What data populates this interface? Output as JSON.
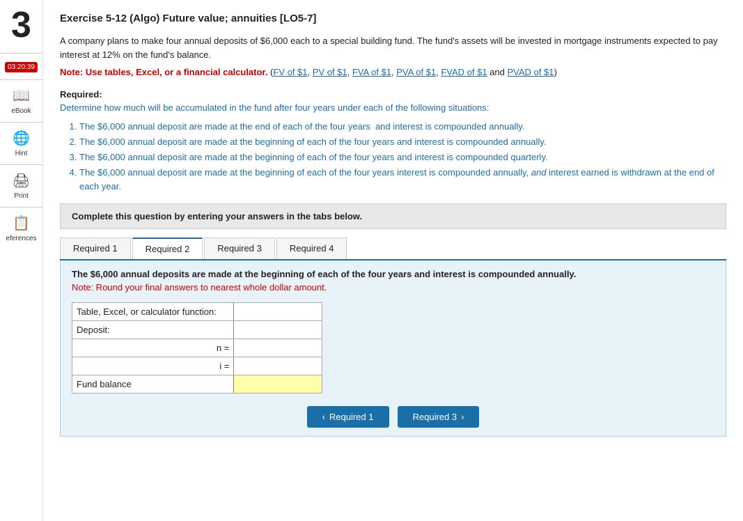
{
  "sidebar": {
    "number": "3",
    "timer": "03:20:39",
    "ebook_label": "eBook",
    "hint_label": "Hint",
    "print_label": "Print",
    "references_label": "eferences"
  },
  "exercise": {
    "title": "Exercise 5-12 (Algo) Future value; annuities [LO5-7]",
    "intro": "A company plans to make four annual deposits of $6,000 each to a special building fund. The fund's assets will be invested in mortgage instruments expected to pay interest at 12% on the fund's balance.",
    "note_bold": "Note: Use tables, Excel, or a financial calculator.",
    "note_links_text": "(FV of $1, PV of $1, FVA of $1, PVA of $1, FVAD of $1 and PVAD of $1)",
    "links": [
      {
        "label": "FV of $1"
      },
      {
        "label": "PV of $1"
      },
      {
        "label": "FVA of $1"
      },
      {
        "label": "PVA of $1"
      },
      {
        "label": "FVAD of $1"
      },
      {
        "label": "PVAD of $1"
      }
    ],
    "required_label": "Required:",
    "determine_text": "Determine how much will be accumulated in the fund after four years under each of the following situations:",
    "list_items": [
      "The $6,000 annual deposit are made at the end of each of the four years  and interest is compounded annually.",
      "The $6,000 annual deposit are made at the beginning of each of the four years and interest is compounded annually.",
      "The $6,000 annual deposit are made at the beginning of each of the four years and interest is compounded quarterly.",
      "The $6,000 annual deposit are made at the beginning of each of the four years interest is compounded annually, and interest earned is withdrawn at the end of each year."
    ],
    "instruction": "Complete this question by entering your answers in the tabs below."
  },
  "tabs": [
    {
      "label": "Required 1",
      "active": false
    },
    {
      "label": "Required 2",
      "active": true
    },
    {
      "label": "Required 3",
      "active": false
    },
    {
      "label": "Required 4",
      "active": false
    }
  ],
  "tab_content": {
    "intro": "The $6,000 annual deposits are made at the beginning of each of the four years and interest is compounded annually.",
    "note": "Note: Round your final answers to nearest whole dollar amount.",
    "form_rows": [
      {
        "label": "Table, Excel, or calculator function:",
        "input_value": "",
        "type": "normal"
      },
      {
        "label": "Deposit:",
        "input_value": "",
        "type": "normal"
      },
      {
        "label": "n =",
        "input_value": "",
        "type": "normal",
        "align_right": true
      },
      {
        "label": "i =",
        "input_value": "",
        "type": "normal",
        "align_right": true
      },
      {
        "label": "Fund balance",
        "input_value": "",
        "type": "fund"
      }
    ]
  },
  "buttons": {
    "prev_label": "< Required 1",
    "next_label": "Required 3 >"
  }
}
